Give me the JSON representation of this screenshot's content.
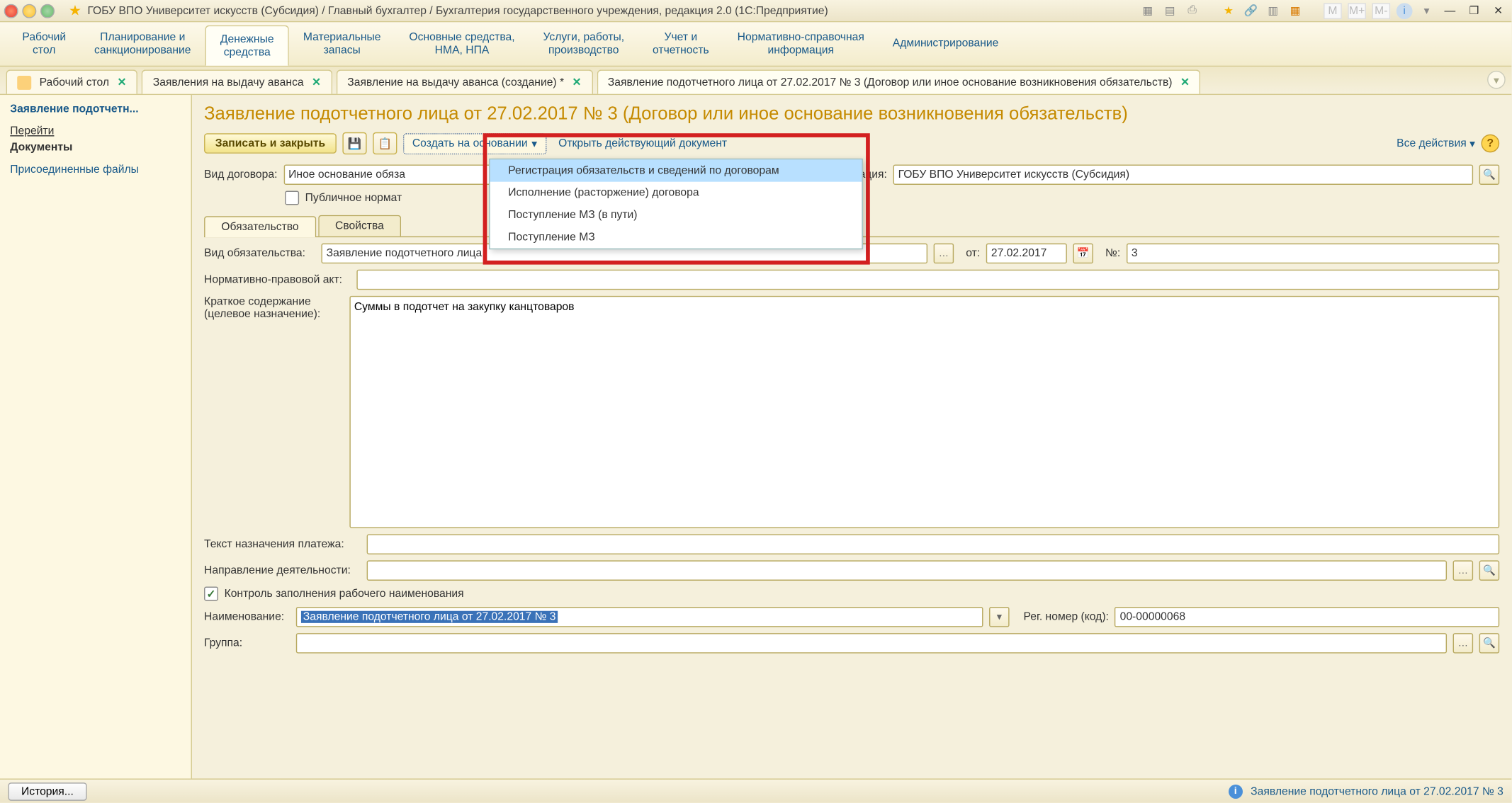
{
  "titlebar": {
    "text": "ГОБУ ВПО Университет искусств (Субсидия) / Главный бухгалтер / Бухгалтерия государственного учреждения, редакция 2.0  (1С:Предприятие)",
    "m_labels": [
      "M",
      "M+",
      "M-"
    ]
  },
  "mainmenu": [
    {
      "l1": "Рабочий",
      "l2": "стол"
    },
    {
      "l1": "Планирование и",
      "l2": "санкционирование"
    },
    {
      "l1": "Денежные",
      "l2": "средства"
    },
    {
      "l1": "Материальные",
      "l2": "запасы"
    },
    {
      "l1": "Основные средства,",
      "l2": "НМА, НПА"
    },
    {
      "l1": "Услуги, работы,",
      "l2": "производство"
    },
    {
      "l1": "Учет и",
      "l2": "отчетность"
    },
    {
      "l1": "Нормативно-справочная",
      "l2": "информация"
    },
    {
      "l1": "Администрирование",
      "l2": ""
    }
  ],
  "tabs": [
    {
      "label": "Рабочий стол",
      "active": false,
      "icon": true
    },
    {
      "label": "Заявления на выдачу аванса",
      "active": false
    },
    {
      "label": "Заявление на выдачу аванса (создание) *",
      "active": false
    },
    {
      "label": "Заявление подотчетного лица от 27.02.2017 № 3 (Договор или иное основание возникновения обязательств)",
      "active": true
    }
  ],
  "sidebar": {
    "title": "Заявление подотчетн...",
    "nav_label": "Перейти",
    "docs_label": "Документы",
    "files_label": "Присоединенные файлы"
  },
  "page": {
    "heading": "Заявление подотчетного лица от 27.02.2017 № 3 (Договор или иное основание возникновения обязательств)"
  },
  "toolbar": {
    "save_close": "Записать и закрыть",
    "create_based": "Создать на основании",
    "open_active": "Открыть действующий документ",
    "all_actions": "Все действия"
  },
  "dropdown": {
    "items": [
      "Регистрация обязательств и сведений по договорам",
      "Исполнение (расторжение) договора",
      "Поступление МЗ (в пути)",
      "Поступление МЗ"
    ]
  },
  "form": {
    "contract_type_label": "Вид договора:",
    "contract_type_value": "Иное основание обяза",
    "org_label": "Организация:",
    "org_value": "ГОБУ ВПО Университет искусств (Субсидия)",
    "public_npa_label": "Публичное нормат",
    "tab_obligation": "Обязательство",
    "tab_properties": "Свойства",
    "obligation_type_label": "Вид обязательства:",
    "obligation_type_value": "Заявление подотчетного лица",
    "date_label": "от:",
    "date_value": "27.02.2017",
    "number_label": "№:",
    "number_value": "3",
    "npa_label": "Нормативно-правовой акт:",
    "summary_label1": "Краткое содержание",
    "summary_label2": "(целевое назначение):",
    "summary_value": "Суммы в подотчет на закупку канцтоваров",
    "payment_text_label": "Текст назначения платежа:",
    "activity_label": "Направление деятельности:",
    "control_label": "Контроль заполнения рабочего наименования",
    "name_label": "Наименование:",
    "name_value": "Заявление подотчетного лица от 27.02.2017 № 3",
    "reg_label": "Рег. номер (код):",
    "reg_value": "00-00000068",
    "group_label": "Группа:"
  },
  "statusbar": {
    "history": "История...",
    "text": "Заявление подотчетного лица от 27.02.2017 № 3"
  }
}
